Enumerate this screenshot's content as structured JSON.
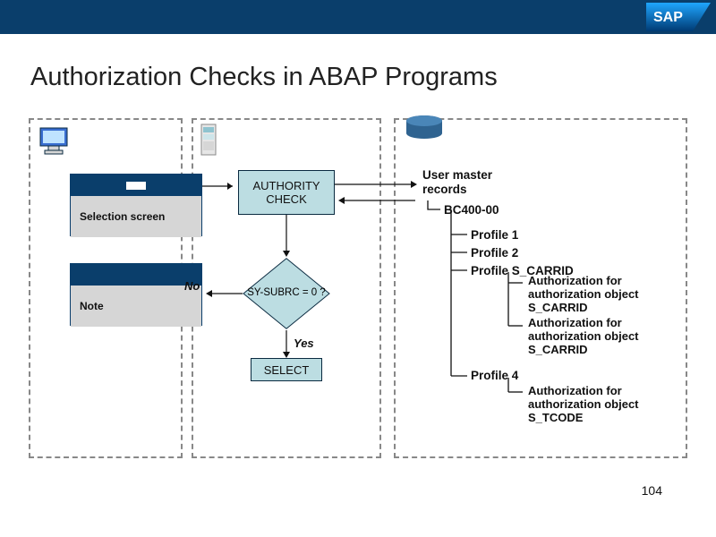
{
  "header": {
    "logo": "SAP"
  },
  "title": "Authorization Checks in ABAP Programs",
  "page_number": "104",
  "panelA": {
    "icon": "monitor-icon",
    "box1": "Selection screen",
    "box2": "Note"
  },
  "panelB": {
    "icon": "server-icon",
    "authority": "AUTHORITY CHECK",
    "decision": "SY-SUBRC = 0 ?",
    "select": "SELECT",
    "yes": "Yes",
    "no": "No"
  },
  "panelC": {
    "icon": "database-icon",
    "root_l1": "User master",
    "root_l2": "records",
    "user": "BC400-00",
    "profiles": {
      "p1": "Profile 1",
      "p2": "Profile 2",
      "p3": "Profile S_CARRID",
      "p3_auth1": "Authorization for authorization object S_CARRID",
      "p3_auth2": "Authorization for authorization object S_CARRID",
      "p4": "Profile 4",
      "p4_auth": "Authorization for authorization object S_TCODE"
    }
  }
}
